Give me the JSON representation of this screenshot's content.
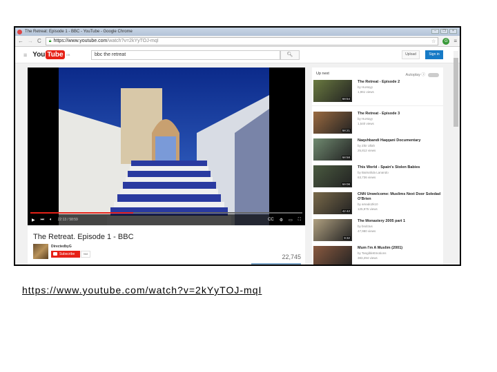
{
  "window": {
    "title": "The Retreat: Episode 1 - BBC - YouTube - Google Chrome"
  },
  "browser": {
    "url_host": "https://www.youtube.com",
    "url_path": "/watch?v=2kYyTOJ-mqI"
  },
  "youtube": {
    "logo_you": "You",
    "logo_tube": "Tube",
    "region": "GB",
    "search_value": "bbc the retreat",
    "upload": "Upload",
    "signin": "Sign in"
  },
  "player": {
    "time": "22:13 / 58:59",
    "progress": 0.377
  },
  "video": {
    "title": "The Retreat. Episode 1 - BBC",
    "channel": "DirectedbyG",
    "subscribe": "Subscribe",
    "subscribers": "968",
    "views": "22,745"
  },
  "sidebar": {
    "up_next": "Up next",
    "autoplay": "Autoplay",
    "items": [
      {
        "title": "The Retreat - Episode 2",
        "by": "by HuHayy",
        "views": "1,961 views",
        "duration": "58:54",
        "color": "#6a7a40"
      },
      {
        "title": "The Retreat - Episode 3",
        "by": "by HuHayy",
        "views": "1,540 views",
        "duration": "58:21",
        "color": "#9a6a40"
      },
      {
        "title": "Naqshbandi Haqqani Documentary",
        "by": "by Zikr Ullah",
        "views": "25,812 views",
        "duration": "58:58",
        "color": "#708a70"
      },
      {
        "title": "This World - Spain's Stolen Babies",
        "by": "by Baimafula Lanando",
        "views": "63,736 views",
        "duration": "59:08",
        "color": "#4a5a40"
      },
      {
        "title": "CNN Unwelcome: Muslims Next Door Soledad O'Brien",
        "by": "by amado2k10",
        "views": "125,975 views",
        "duration": "42:42",
        "color": "#7a6a4a"
      },
      {
        "title": "The Monastery 2005 part 1",
        "by": "by bndctus",
        "views": "47,980 views",
        "duration": "9:32",
        "color": "#b0a080"
      },
      {
        "title": "Mum I'm A Muslim (2001)",
        "by": "by TangibleEmotions",
        "views": "383,294 views",
        "duration": "",
        "color": "#8a5a40"
      }
    ]
  },
  "caption": {
    "link": "https://www.youtube.com/watch?v=2kYyTOJ-mqI"
  }
}
